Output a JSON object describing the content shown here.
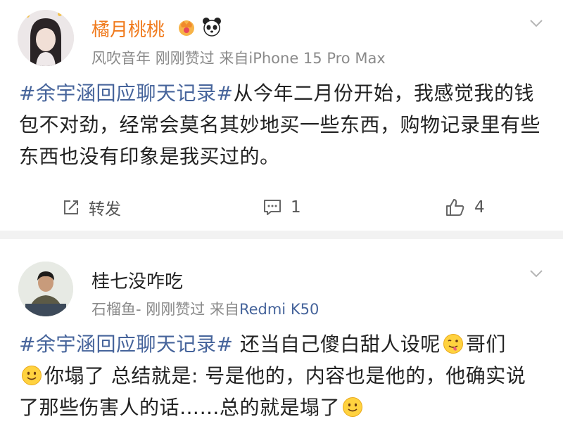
{
  "posts": [
    {
      "user_name": "橘月桃桃",
      "time": "刚刚赞过",
      "source_prefix": "风吹音年",
      "source_from": "来自",
      "source_device": "iPhone 15 Pro Max",
      "hashtag": "#余宇涵回应聊天记录#",
      "body": "从今年二月份开始，我感觉我的钱包不对劲，经常会莫名其妙地买一些东西，购物记录里有些东西也没有印象是我买过的。",
      "actions": {
        "repost_label": "转发",
        "comment_count": "1",
        "like_count": "4"
      }
    },
    {
      "user_name": "桂七没咋吃",
      "time": "刚刚赞过",
      "source_prefix": "石榴鱼-",
      "source_from": "来自",
      "source_device": "Redmi K50",
      "hashtag": "#余宇涵回应聊天记录#",
      "body_part1": " 还当自己傻白甜人设呢",
      "body_part2": "哥们",
      "body_part3": "你塌了 总结就是: 号是他的，内容也是他的，他确实说了那些伤害人的话……总的就是塌了"
    }
  ],
  "colors": {
    "hashtag": "#46649b",
    "vip_name": "#f07a1c",
    "meta": "#8a8a8a",
    "divider": "#f2f2f2"
  },
  "icons": [
    "chevron-down-icon",
    "crown-badge-icon",
    "panda-badge-icon",
    "repost-icon",
    "comment-icon",
    "like-icon",
    "smile-emoji-icon",
    "tongue-emoji-icon"
  ]
}
